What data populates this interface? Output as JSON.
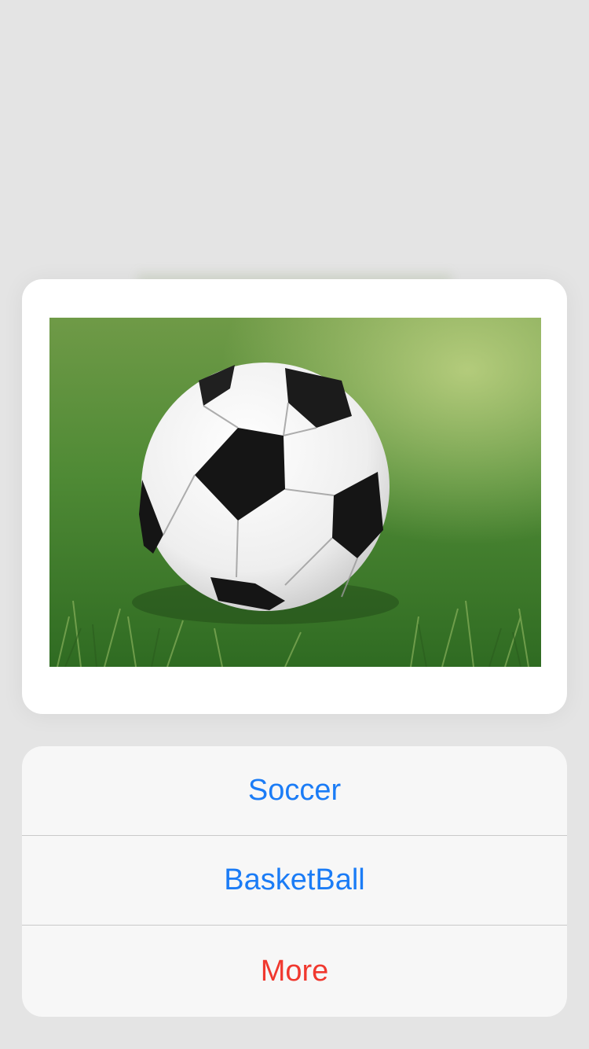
{
  "preview": {
    "image_alt": "soccer ball on grass",
    "icon": "soccer-ball-photo"
  },
  "action_sheet": {
    "items": [
      {
        "label": "Soccer",
        "style": "default"
      },
      {
        "label": "BasketBall",
        "style": "default"
      },
      {
        "label": "More",
        "style": "destructive"
      }
    ]
  },
  "colors": {
    "accent": "#1b7cf6",
    "destructive": "#f0382e",
    "backdrop": "#e4e4e4",
    "sheet_bg": "#f7f7f7"
  }
}
